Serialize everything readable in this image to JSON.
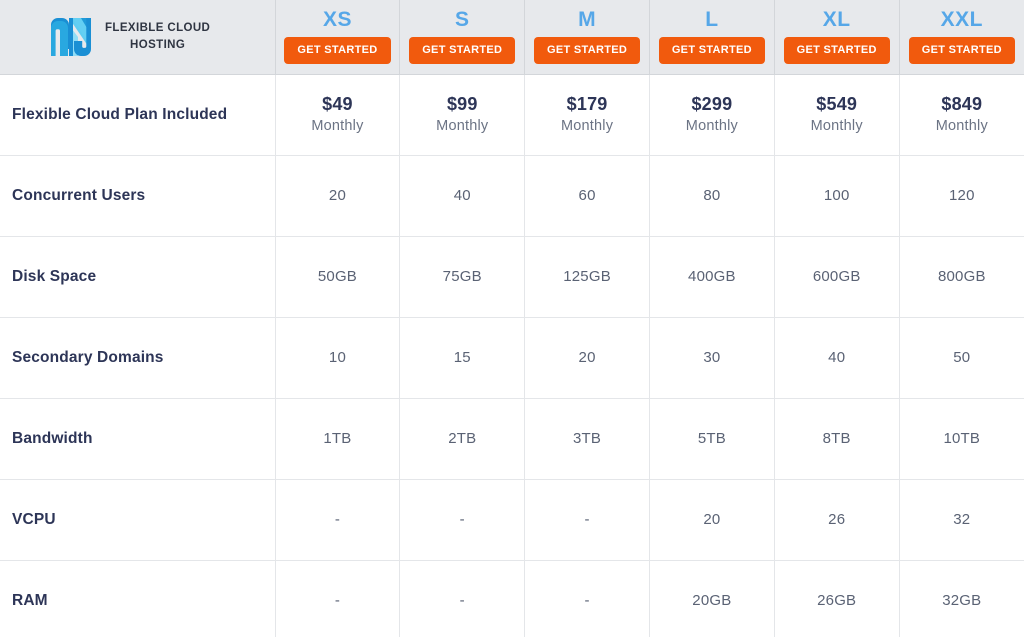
{
  "brand": {
    "name": "FLEXIBLE CLOUD\nHOSTING",
    "logo_icon": "n-monogram-logo",
    "logo_colors": {
      "dark_blue": "#1a8fd4",
      "mid_blue": "#29a8e0",
      "light_cyan": "#5fcdf2",
      "pale_cyan": "#8fddf7"
    }
  },
  "theme": {
    "header_bg": "#e7e9ec",
    "tier_label_color": "#56a7e8",
    "cta_color": "#f15a0d",
    "feature_text_color": "#2d3557",
    "value_text_color": "#5a6274",
    "border_color": "#e4e6e9"
  },
  "cta_label": "GET STARTED",
  "plans": [
    {
      "tier": "XS",
      "price": "$49",
      "period": "Monthly"
    },
    {
      "tier": "S",
      "price": "$99",
      "period": "Monthly"
    },
    {
      "tier": "M",
      "price": "$179",
      "period": "Monthly"
    },
    {
      "tier": "L",
      "price": "$299",
      "period": "Monthly"
    },
    {
      "tier": "XL",
      "price": "$549",
      "period": "Monthly"
    },
    {
      "tier": "XXL",
      "price": "$849",
      "period": "Monthly"
    }
  ],
  "rows": [
    {
      "label": "Flexible Cloud Plan Included",
      "type": "price",
      "values": [
        "$49",
        "$99",
        "$179",
        "$299",
        "$549",
        "$849"
      ],
      "periods": [
        "Monthly",
        "Monthly",
        "Monthly",
        "Monthly",
        "Monthly",
        "Monthly"
      ]
    },
    {
      "label": "Concurrent Users",
      "type": "value",
      "values": [
        "20",
        "40",
        "60",
        "80",
        "100",
        "120"
      ]
    },
    {
      "label": "Disk Space",
      "type": "value",
      "values": [
        "50GB",
        "75GB",
        "125GB",
        "400GB",
        "600GB",
        "800GB"
      ]
    },
    {
      "label": "Secondary Domains",
      "type": "value",
      "values": [
        "10",
        "15",
        "20",
        "30",
        "40",
        "50"
      ]
    },
    {
      "label": "Bandwidth",
      "type": "value",
      "values": [
        "1TB",
        "2TB",
        "3TB",
        "5TB",
        "8TB",
        "10TB"
      ]
    },
    {
      "label": "VCPU",
      "type": "value",
      "values": [
        "-",
        "-",
        "-",
        "20",
        "26",
        "32"
      ]
    },
    {
      "label": "RAM",
      "type": "value",
      "values": [
        "-",
        "-",
        "-",
        "20GB",
        "26GB",
        "32GB"
      ]
    }
  ]
}
